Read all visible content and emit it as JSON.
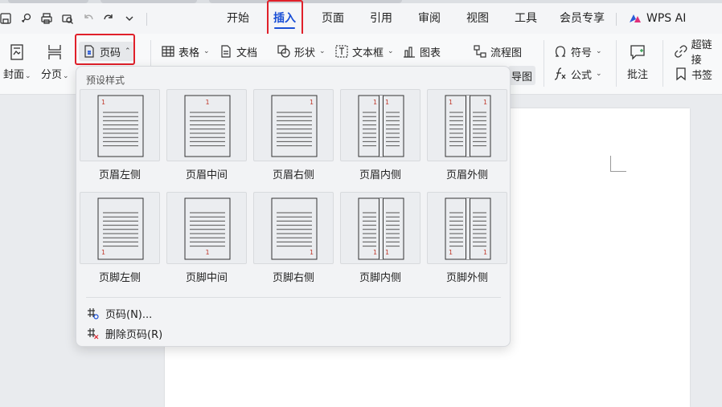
{
  "tabs": [
    {
      "key": "start",
      "label": "开始"
    },
    {
      "key": "insert",
      "label": "插入"
    },
    {
      "key": "page",
      "label": "页面"
    },
    {
      "key": "ref",
      "label": "引用"
    },
    {
      "key": "review",
      "label": "审阅"
    },
    {
      "key": "view",
      "label": "视图"
    },
    {
      "key": "tools",
      "label": "工具"
    },
    {
      "key": "member",
      "label": "会员专享"
    }
  ],
  "wps_ai_label": "WPS AI",
  "ribbon": {
    "cover": "封面",
    "page_break": "分页",
    "page_number": "页码",
    "table": "表格",
    "document": "文档",
    "shape": "形状",
    "textbox": "文本框",
    "chart": "图表",
    "flowchart": "流程图",
    "mindmap_partial": "导图",
    "symbol": "符号",
    "formula": "公式",
    "comment": "批注",
    "hyperlink": "超链接",
    "bookmark": "书签"
  },
  "dropdown": {
    "title": "预设样式",
    "header_styles": [
      "页眉左侧",
      "页眉中间",
      "页眉右侧",
      "页眉内侧",
      "页眉外侧"
    ],
    "footer_styles": [
      "页脚左侧",
      "页脚中间",
      "页脚右侧",
      "页脚内侧",
      "页脚外侧"
    ],
    "page_digit": "1",
    "page_number_item": "页码(N)...",
    "delete_item": "删除页码(R)"
  },
  "colors": {
    "accent": "#1a4fd6",
    "highlight": "#e0202a",
    "page_digit": "#c0392b"
  }
}
